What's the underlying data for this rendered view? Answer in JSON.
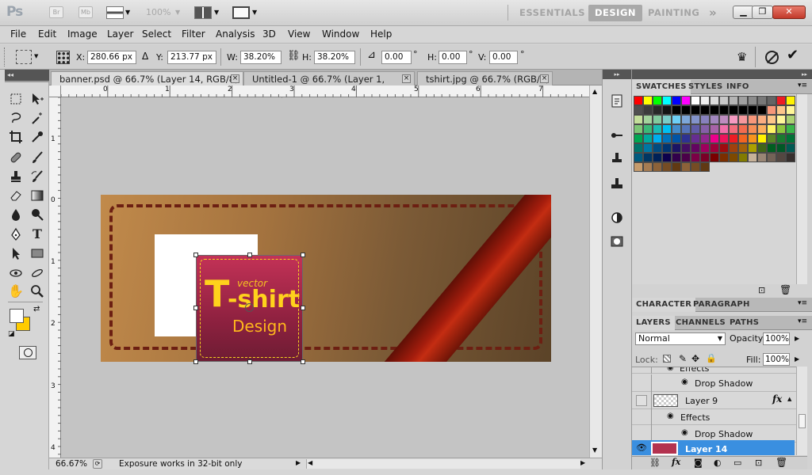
{
  "app": {
    "logo": "Ps",
    "bridge_labels": [
      "Br",
      "Mb"
    ],
    "zoom_display": "100%",
    "workspaces": [
      "ESSENTIALS",
      "DESIGN",
      "PAINTING"
    ],
    "active_workspace": "DESIGN"
  },
  "menu": [
    "File",
    "Edit",
    "Image",
    "Layer",
    "Select",
    "Filter",
    "Analysis",
    "3D",
    "View",
    "Window",
    "Help"
  ],
  "options": {
    "x_label": "X:",
    "x_value": "280.66 px",
    "y_label": "Y:",
    "y_value": "213.77 px",
    "w_label": "W:",
    "w_value": "38.20%",
    "h_label": "H:",
    "h_value": "38.20%",
    "angle_value": "0.00",
    "angle_unit": "°",
    "hskew_label": "H:",
    "hskew_value": "0.00",
    "hskew_unit": "°",
    "vskew_label": "V:",
    "vskew_value": "0.00",
    "vskew_unit": "°"
  },
  "tabs": [
    {
      "label": "banner.psd @ 66.7% (Layer 14, RGB/8) *",
      "close": "×",
      "active": true
    },
    {
      "label": "Untitled-1 @ 66.7% (Layer 1, RGB/8)",
      "close": "×",
      "active": false
    },
    {
      "label": "tshirt.jpg @ 66.7% (RGB/8)",
      "close": "×",
      "active": false
    }
  ],
  "rulers": {
    "h": [
      "0",
      "1",
      "2",
      "3",
      "4",
      "5",
      "6",
      "7"
    ],
    "v": [
      "0",
      "1",
      "2",
      "3",
      "4"
    ],
    "h_partial": [
      "1"
    ]
  },
  "canvas_art": {
    "line1": "vector",
    "line2_big": "T",
    "line2_rest": "-shirt",
    "line3": "Design"
  },
  "status": {
    "zoom": "66.67%",
    "message": "Exposure works in 32-bit only"
  },
  "swatches_panel": {
    "tabs": [
      "SWATCHES",
      "STYLES",
      "INFO"
    ],
    "colors": [
      "#ff0000",
      "#ffff00",
      "#00ff00",
      "#00ffff",
      "#0000ff",
      "#ff00ff",
      "#ffffff",
      "#f0f0f0",
      "#dcdcdc",
      "#c8c8c8",
      "#b4b4b4",
      "#a0a0a0",
      "#8c8c8c",
      "#787878",
      "#646464",
      "#ed1c24",
      "#fff200",
      "#505050",
      "#3c3c3c",
      "#282828",
      "#141414",
      "#000000",
      "#000000",
      "#000000",
      "#000000",
      "#000000",
      "#000000",
      "#000000",
      "#000000",
      "#000000",
      "#000000",
      "#f69679",
      "#fdc68a",
      "#fff799",
      "#c4df9b",
      "#a3d39c",
      "#82ca9d",
      "#7accc8",
      "#6dcff6",
      "#7da7d9",
      "#8393ca",
      "#8781bd",
      "#a187be",
      "#bd8cbf",
      "#f49ac1",
      "#f5989d",
      "#f7977a",
      "#f9ad81",
      "#fdc689",
      "#fff79a",
      "#acd373",
      "#7cc576",
      "#3bb878",
      "#1abbb4",
      "#00bff3",
      "#438ccb",
      "#5574b9",
      "#605ca8",
      "#855fa8",
      "#a763a8",
      "#f06ea9",
      "#f26d7d",
      "#f26c4f",
      "#f68e56",
      "#fbaf5d",
      "#fff467",
      "#8dc63f",
      "#39b54a",
      "#00a651",
      "#00a99d",
      "#00aeef",
      "#0072bc",
      "#0054a6",
      "#2e3192",
      "#662d91",
      "#92278f",
      "#ec008c",
      "#ed145b",
      "#ed1c24",
      "#f26522",
      "#f7941d",
      "#fff200",
      "#598527",
      "#197b30",
      "#007236",
      "#00746b",
      "#0076a3",
      "#004b80",
      "#003471",
      "#1b1464",
      "#440e62",
      "#630460",
      "#9e005d",
      "#9e0039",
      "#9e0b0f",
      "#a0410d",
      "#a36209",
      "#aba000",
      "#406618",
      "#005e20",
      "#005826",
      "#005952",
      "#005b7f",
      "#003663",
      "#002157",
      "#0d004c",
      "#32004b",
      "#4b0049",
      "#7b0046",
      "#7a0026",
      "#790000",
      "#7b2e00",
      "#7d4900",
      "#827b00",
      "#c7b299",
      "#998675",
      "#736357",
      "#534741",
      "#362f2d",
      "#c69c6d",
      "#a67c52",
      "#8c6239",
      "#754c24",
      "#603913",
      "#8c6239",
      "#754c24",
      "#603913"
    ],
    "rows": [
      17,
      17,
      17,
      17,
      17,
      17,
      17,
      11,
      3
    ]
  },
  "character_panel": {
    "tabs": [
      "CHARACTER",
      "PARAGRAPH"
    ]
  },
  "layers_panel": {
    "tabs": [
      "LAYERS",
      "CHANNELS",
      "PATHS"
    ],
    "blend_mode": "Normal",
    "opacity_label": "Opacity:",
    "opacity_value": "100%",
    "lock_label": "Lock:",
    "fill_label": "Fill:",
    "fill_value": "100%",
    "rows": [
      {
        "label": "Effects",
        "type": "effects"
      },
      {
        "label": "Drop Shadow",
        "type": "effect"
      },
      {
        "label": "Layer 9",
        "type": "layer",
        "fx": "fx"
      },
      {
        "label": "Effects",
        "type": "effects"
      },
      {
        "label": "Drop Shadow",
        "type": "effect"
      },
      {
        "label": "Layer 14",
        "type": "layer-selected",
        "fx": "fx"
      }
    ]
  }
}
